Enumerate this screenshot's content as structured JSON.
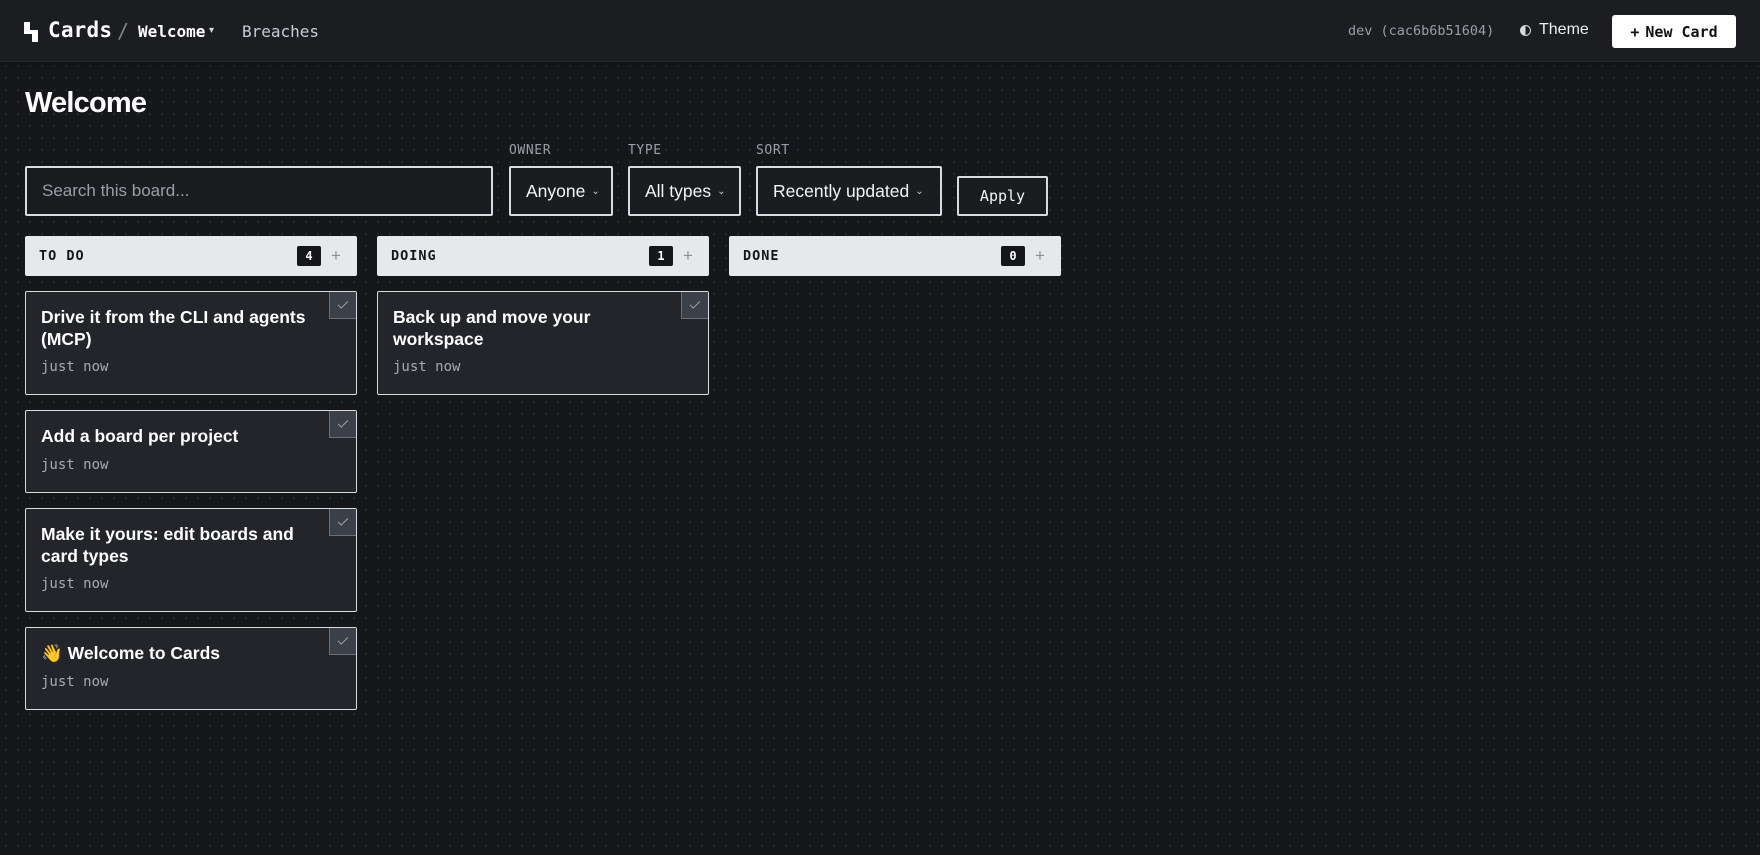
{
  "topbar": {
    "brand": "Cards",
    "breadcrumb_sep": "/",
    "board_name": "Welcome",
    "board_caret": "▾",
    "nav_breaches": "Breaches",
    "env_label": "dev (cac6b6b51604)",
    "theme_label": "Theme",
    "new_card_plus": "+",
    "new_card_label": "New Card"
  },
  "page": {
    "title": "Welcome"
  },
  "filters": {
    "search_placeholder": "Search this board...",
    "owner_label": "OWNER",
    "owner_value": "Anyone",
    "type_label": "TYPE",
    "type_value": "All types",
    "sort_label": "SORT",
    "sort_value": "Recently updated",
    "chevron": "⌄",
    "apply_label": "Apply"
  },
  "columns": [
    {
      "title": "TO DO",
      "count": "4",
      "add": "+",
      "cards": [
        {
          "title": "Drive it from the CLI and agents (MCP)",
          "time": "just now"
        },
        {
          "title": "Add a board per project",
          "time": "just now"
        },
        {
          "title": "Make it yours: edit boards and card types",
          "time": "just now"
        },
        {
          "title": "👋 Welcome to Cards",
          "time": "just now"
        }
      ]
    },
    {
      "title": "DOING",
      "count": "1",
      "add": "+",
      "cards": [
        {
          "title": "Back up and move your workspace",
          "time": "just now"
        }
      ]
    },
    {
      "title": "DONE",
      "count": "0",
      "add": "+",
      "cards": []
    }
  ]
}
